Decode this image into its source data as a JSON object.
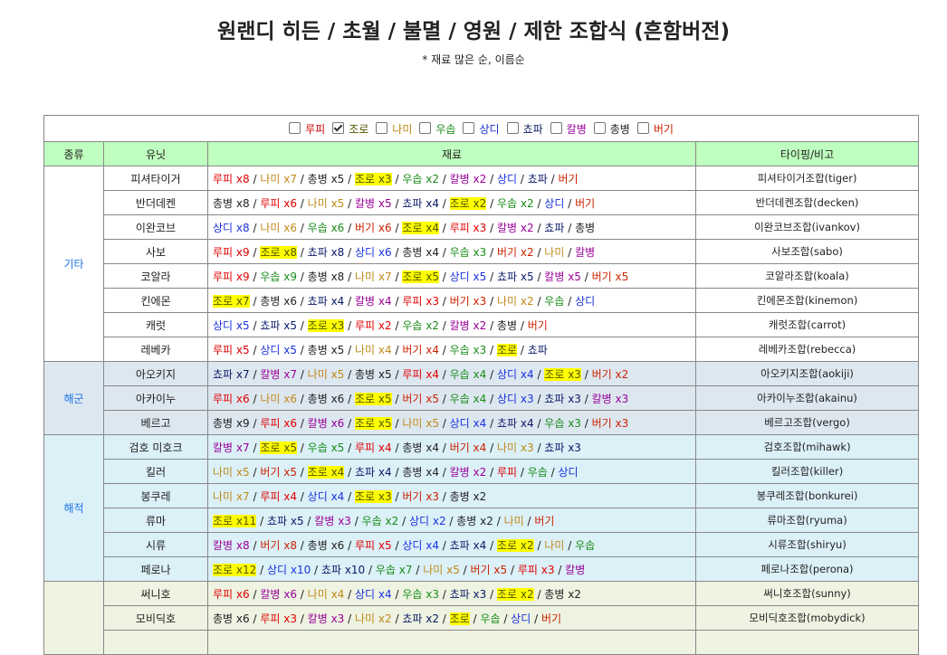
{
  "title": "원랜디 히든 / 초월 / 불멸 / 영원 / 제한 조합식 (흔함버전)",
  "subtitle": "* 재료 많은 순, 이름순",
  "filters": [
    {
      "label": "루피",
      "checked": false,
      "color": "#cc0000"
    },
    {
      "label": "조로",
      "checked": true,
      "color": "#555500"
    },
    {
      "label": "나미",
      "checked": false,
      "color": "#b8860b"
    },
    {
      "label": "우솝",
      "checked": false,
      "color": "#1a8c1a"
    },
    {
      "label": "상디",
      "checked": false,
      "color": "#1a33cc"
    },
    {
      "label": "쵸파",
      "checked": false,
      "color": "#0a1a66"
    },
    {
      "label": "칼병",
      "checked": false,
      "color": "#990099"
    },
    {
      "label": "총병",
      "checked": false,
      "color": "#222222"
    },
    {
      "label": "버기",
      "checked": false,
      "color": "#cc2200"
    }
  ],
  "headers": {
    "type": "종류",
    "unit": "유닛",
    "materials": "재료",
    "note": "타이핑/비고"
  },
  "material_colors": {
    "루피": "#e00000",
    "조로": "#555500",
    "나미": "#c08a1a",
    "우솝": "#1a8c1a",
    "상디": "#1a33dd",
    "쵸파": "#0a1a66",
    "칼병": "#990099",
    "총병": "#222222",
    "버기": "#cc2200"
  },
  "highlight_material": "조로",
  "groups": [
    {
      "type": "기타",
      "cls": "g-other",
      "rows": [
        {
          "unit": "피셔타이거",
          "note": "피셔타이거조합(tiger)",
          "mats": [
            [
              "루피",
              "x8"
            ],
            [
              "나미",
              "x7"
            ],
            [
              "총병",
              "x5"
            ],
            [
              "조로",
              "x3"
            ],
            [
              "우솝",
              "x2"
            ],
            [
              "칼병",
              "x2"
            ],
            [
              "상디",
              ""
            ],
            [
              "쵸파",
              ""
            ],
            [
              "버기",
              ""
            ]
          ]
        },
        {
          "unit": "반더데켄",
          "note": "반더데켄조합(decken)",
          "mats": [
            [
              "총병",
              "x8"
            ],
            [
              "루피",
              "x6"
            ],
            [
              "나미",
              "x5"
            ],
            [
              "칼병",
              "x5"
            ],
            [
              "쵸파",
              "x4"
            ],
            [
              "조로",
              "x2"
            ],
            [
              "우솝",
              "x2"
            ],
            [
              "상디",
              ""
            ],
            [
              "버기",
              ""
            ]
          ]
        },
        {
          "unit": "이완코브",
          "note": "이완코브조합(ivankov)",
          "mats": [
            [
              "상디",
              "x8"
            ],
            [
              "나미",
              "x6"
            ],
            [
              "우솝",
              "x6"
            ],
            [
              "버기",
              "x6"
            ],
            [
              "조로",
              "x4"
            ],
            [
              "루피",
              "x3"
            ],
            [
              "칼병",
              "x2"
            ],
            [
              "쵸파",
              ""
            ],
            [
              "총병",
              ""
            ]
          ]
        },
        {
          "unit": "사보",
          "note": "사보조합(sabo)",
          "mats": [
            [
              "루피",
              "x9"
            ],
            [
              "조로",
              "x8"
            ],
            [
              "쵸파",
              "x8"
            ],
            [
              "상디",
              "x6"
            ],
            [
              "총병",
              "x4"
            ],
            [
              "우솝",
              "x3"
            ],
            [
              "버기",
              "x2"
            ],
            [
              "나미",
              ""
            ],
            [
              "칼병",
              ""
            ]
          ]
        },
        {
          "unit": "코알라",
          "note": "코알라조합(koala)",
          "mats": [
            [
              "루피",
              "x9"
            ],
            [
              "우솝",
              "x9"
            ],
            [
              "총병",
              "x8"
            ],
            [
              "나미",
              "x7"
            ],
            [
              "조로",
              "x5"
            ],
            [
              "상디",
              "x5"
            ],
            [
              "쵸파",
              "x5"
            ],
            [
              "칼병",
              "x5"
            ],
            [
              "버기",
              "x5"
            ]
          ]
        },
        {
          "unit": "킨에몬",
          "note": "킨에몬조합(kinemon)",
          "mats": [
            [
              "조로",
              "x7"
            ],
            [
              "총병",
              "x6"
            ],
            [
              "쵸파",
              "x4"
            ],
            [
              "칼병",
              "x4"
            ],
            [
              "루피",
              "x3"
            ],
            [
              "버기",
              "x3"
            ],
            [
              "나미",
              "x2"
            ],
            [
              "우솝",
              ""
            ],
            [
              "상디",
              ""
            ]
          ]
        },
        {
          "unit": "캐럿",
          "note": "캐럿조합(carrot)",
          "mats": [
            [
              "상디",
              "x5"
            ],
            [
              "쵸파",
              "x5"
            ],
            [
              "조로",
              "x3"
            ],
            [
              "루피",
              "x2"
            ],
            [
              "우솝",
              "x2"
            ],
            [
              "칼병",
              "x2"
            ],
            [
              "총병",
              ""
            ],
            [
              "버기",
              ""
            ]
          ]
        },
        {
          "unit": "레베카",
          "note": "레베카조합(rebecca)",
          "mats": [
            [
              "루피",
              "x5"
            ],
            [
              "상디",
              "x5"
            ],
            [
              "총병",
              "x5"
            ],
            [
              "나미",
              "x4"
            ],
            [
              "버기",
              "x4"
            ],
            [
              "우솝",
              "x3"
            ],
            [
              "조로",
              ""
            ],
            [
              "쵸파",
              ""
            ]
          ]
        }
      ]
    },
    {
      "type": "해군",
      "cls": "g-navy",
      "rows": [
        {
          "unit": "아오키지",
          "note": "아오키지조합(aokiji)",
          "mats": [
            [
              "쵸파",
              "x7"
            ],
            [
              "칼병",
              "x7"
            ],
            [
              "나미",
              "x5"
            ],
            [
              "총병",
              "x5"
            ],
            [
              "루피",
              "x4"
            ],
            [
              "우솝",
              "x4"
            ],
            [
              "상디",
              "x4"
            ],
            [
              "조로",
              "x3"
            ],
            [
              "버기",
              "x2"
            ]
          ]
        },
        {
          "unit": "아카이누",
          "note": "아카이누조합(akainu)",
          "mats": [
            [
              "루피",
              "x6"
            ],
            [
              "나미",
              "x6"
            ],
            [
              "총병",
              "x6"
            ],
            [
              "조로",
              "x5"
            ],
            [
              "버기",
              "x5"
            ],
            [
              "우솝",
              "x4"
            ],
            [
              "상디",
              "x3"
            ],
            [
              "쵸파",
              "x3"
            ],
            [
              "칼병",
              "x3"
            ]
          ]
        },
        {
          "unit": "베르고",
          "note": "베르고조합(vergo)",
          "mats": [
            [
              "총병",
              "x9"
            ],
            [
              "루피",
              "x6"
            ],
            [
              "칼병",
              "x6"
            ],
            [
              "조로",
              "x5"
            ],
            [
              "나미",
              "x5"
            ],
            [
              "상디",
              "x4"
            ],
            [
              "쵸파",
              "x4"
            ],
            [
              "우솝",
              "x3"
            ],
            [
              "버기",
              "x3"
            ]
          ]
        }
      ]
    },
    {
      "type": "해적",
      "cls": "g-pirate",
      "rows": [
        {
          "unit": "검호 미호크",
          "note": "검호조합(mihawk)",
          "mats": [
            [
              "칼병",
              "x7"
            ],
            [
              "조로",
              "x5"
            ],
            [
              "우솝",
              "x5"
            ],
            [
              "루피",
              "x4"
            ],
            [
              "총병",
              "x4"
            ],
            [
              "버기",
              "x4"
            ],
            [
              "나미",
              "x3"
            ],
            [
              "쵸파",
              "x3"
            ]
          ]
        },
        {
          "unit": "킬러",
          "note": "킬러조합(killer)",
          "mats": [
            [
              "나미",
              "x5"
            ],
            [
              "버기",
              "x5"
            ],
            [
              "조로",
              "x4"
            ],
            [
              "쵸파",
              "x4"
            ],
            [
              "총병",
              "x4"
            ],
            [
              "칼병",
              "x2"
            ],
            [
              "루피",
              ""
            ],
            [
              "우솝",
              ""
            ],
            [
              "상디",
              ""
            ]
          ]
        },
        {
          "unit": "봉쿠레",
          "note": "봉쿠레조합(bonkurei)",
          "mats": [
            [
              "나미",
              "x7"
            ],
            [
              "루피",
              "x4"
            ],
            [
              "상디",
              "x4"
            ],
            [
              "조로",
              "x3"
            ],
            [
              "버기",
              "x3"
            ],
            [
              "총병",
              "x2"
            ]
          ]
        },
        {
          "unit": "류마",
          "note": "류마조합(ryuma)",
          "mats": [
            [
              "조로",
              "x11"
            ],
            [
              "쵸파",
              "x5"
            ],
            [
              "칼병",
              "x3"
            ],
            [
              "우솝",
              "x2"
            ],
            [
              "상디",
              "x2"
            ],
            [
              "총병",
              "x2"
            ],
            [
              "나미",
              ""
            ],
            [
              "버기",
              ""
            ]
          ]
        },
        {
          "unit": "시류",
          "note": "시류조합(shiryu)",
          "mats": [
            [
              "칼병",
              "x8"
            ],
            [
              "버기",
              "x8"
            ],
            [
              "총병",
              "x6"
            ],
            [
              "루피",
              "x5"
            ],
            [
              "상디",
              "x4"
            ],
            [
              "쵸파",
              "x4"
            ],
            [
              "조로",
              "x2"
            ],
            [
              "나미",
              ""
            ],
            [
              "우솝",
              ""
            ]
          ]
        },
        {
          "unit": "페로나",
          "note": "페로나조합(perona)",
          "mats": [
            [
              "조로",
              "x12"
            ],
            [
              "상디",
              "x10"
            ],
            [
              "쵸파",
              "x10"
            ],
            [
              "우솝",
              "x7"
            ],
            [
              "나미",
              "x5"
            ],
            [
              "버기",
              "x5"
            ],
            [
              "루피",
              "x3"
            ],
            [
              "칼병",
              ""
            ]
          ]
        }
      ]
    },
    {
      "type": "",
      "cls": "g-last",
      "rows": [
        {
          "unit": "써니호",
          "note": "써니호조합(sunny)",
          "mats": [
            [
              "루피",
              "x6"
            ],
            [
              "칼병",
              "x6"
            ],
            [
              "나미",
              "x4"
            ],
            [
              "상디",
              "x4"
            ],
            [
              "우솝",
              "x3"
            ],
            [
              "쵸파",
              "x3"
            ],
            [
              "조로",
              "x2"
            ],
            [
              "총병",
              "x2"
            ]
          ]
        },
        {
          "unit": "모비딕호",
          "note": "모비딕호조합(mobydick)",
          "mats": [
            [
              "총병",
              "x6"
            ],
            [
              "루피",
              "x3"
            ],
            [
              "칼병",
              "x3"
            ],
            [
              "나미",
              "x2"
            ],
            [
              "쵸파",
              "x2"
            ],
            [
              "조로",
              ""
            ],
            [
              "우솝",
              ""
            ],
            [
              "상디",
              ""
            ],
            [
              "버기",
              ""
            ]
          ]
        },
        {
          "unit": "",
          "note": "",
          "mats": []
        }
      ]
    }
  ]
}
